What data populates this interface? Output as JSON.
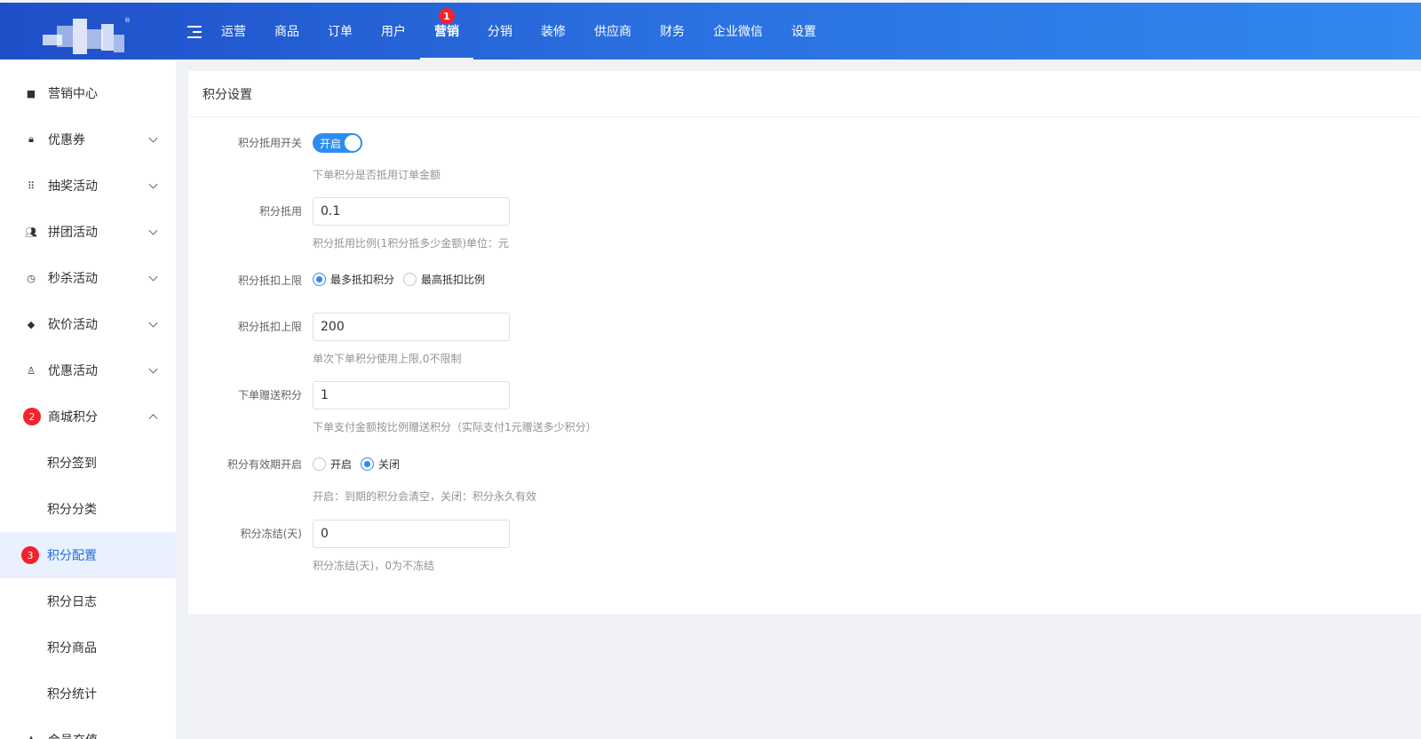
{
  "header": {
    "nav": [
      {
        "label": "运营"
      },
      {
        "label": "商品"
      },
      {
        "label": "订单"
      },
      {
        "label": "用户"
      },
      {
        "label": "营销",
        "active": true,
        "badge": "1"
      },
      {
        "label": "分销"
      },
      {
        "label": "装修"
      },
      {
        "label": "供应商"
      },
      {
        "label": "财务"
      },
      {
        "label": "企业微信"
      },
      {
        "label": "设置"
      }
    ]
  },
  "sidebar": {
    "items": [
      {
        "label": "营销中心",
        "icon": "marketing-center-icon"
      },
      {
        "label": "优惠券",
        "icon": "coupon-icon"
      },
      {
        "label": "抽奖活动",
        "icon": "lottery-icon"
      },
      {
        "label": "拼团活动",
        "icon": "group-buy-icon"
      },
      {
        "label": "秒杀活动",
        "icon": "flash-sale-icon"
      },
      {
        "label": "砍价活动",
        "icon": "bargain-icon"
      },
      {
        "label": "优惠活动",
        "icon": "discount-icon"
      },
      {
        "label": "商城积分",
        "badge": "2"
      }
    ],
    "sub_items": [
      {
        "label": "积分签到"
      },
      {
        "label": "积分分类"
      },
      {
        "label": "积分配置",
        "active": true,
        "badge": "3"
      },
      {
        "label": "积分日志"
      },
      {
        "label": "积分商品"
      },
      {
        "label": "积分统计"
      }
    ],
    "partial_item": {
      "label": "会员充值"
    }
  },
  "content": {
    "title": "积分设置",
    "form": {
      "switch": {
        "label": "积分抵用开关",
        "text": "开启",
        "hint": "下单积分是否抵用订单金额"
      },
      "deduct": {
        "label": "积分抵用",
        "value": "0.1",
        "hint": "积分抵用比例(1积分抵多少金额)单位：元"
      },
      "limit_type": {
        "label": "积分抵扣上限",
        "options": [
          "最多抵扣积分",
          "最高抵扣比例"
        ],
        "selected": 0
      },
      "limit": {
        "label": "积分抵扣上限",
        "value": "200",
        "hint": "单次下单积分使用上限,0不限制"
      },
      "give": {
        "label": "下单赠送积分",
        "value": "1",
        "hint": "下单支付金额按比例赠送积分（实际支付1元赠送多少积分）"
      },
      "expire": {
        "label": "积分有效期开启",
        "options": [
          "开启",
          "关闭"
        ],
        "selected": 1,
        "hint": "开启：到期的积分会清空，关闭：积分永久有效"
      },
      "freeze": {
        "label": "积分冻结(天)",
        "value": "0",
        "hint": "积分冻结(天)，0为不冻结"
      }
    }
  }
}
